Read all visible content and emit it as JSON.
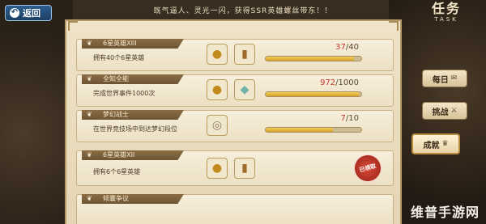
{
  "header": {
    "back_label": "返回",
    "banner_text": "既气逼人、灵光一闪，获得SSR英雄螺丝带东！！",
    "title_cn": "任务",
    "title_en": "TASK"
  },
  "tasks": [
    {
      "name": "6星英雄XIII",
      "desc": "拥有40个6星英雄",
      "progress_current": "37",
      "progress_sep": "/",
      "progress_target": "40",
      "progress_fraction": 0.925,
      "rewards": [
        "coin-icon",
        "card-icon"
      ]
    },
    {
      "name": "全知全能",
      "desc": "完成世界事件1000次",
      "progress_current": "972",
      "progress_sep": "/",
      "progress_target": "1000",
      "progress_fraction": 0.972,
      "rewards": [
        "coin-icon",
        "gem-icon"
      ]
    },
    {
      "name": "梦幻战士",
      "desc": "在世界竞技场中到达梦幻段位",
      "progress_current": "7",
      "progress_sep": "/",
      "progress_target": "10",
      "progress_fraction": 0.7,
      "rewards": [
        "ring-icon"
      ]
    },
    {
      "name": "6星英雄XII",
      "desc": "拥有6个6星英雄",
      "claimed_label": "已领取",
      "rewards": [
        "coin-icon",
        "card-icon"
      ]
    },
    {
      "name": "倾囊争议",
      "desc": ""
    }
  ],
  "side_tabs": [
    {
      "label": "每日",
      "icon": "mail-icon"
    },
    {
      "label": "挑战",
      "icon": "sword-icon"
    },
    {
      "label": "成就",
      "icon": "trophy-icon",
      "active": true
    }
  ],
  "watermark": "维普手游网",
  "colors": {
    "progress_current": "#c9392c",
    "bar_fill": "#d8a026",
    "claimed_stamp": "#b0281c",
    "back_button": "#2e5e8e"
  }
}
